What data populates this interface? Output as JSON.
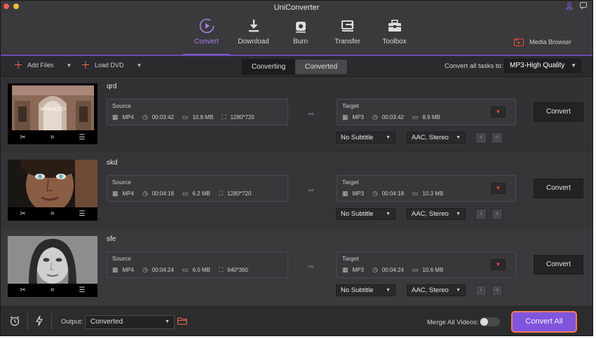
{
  "window": {
    "title": "UniConverter"
  },
  "nav": {
    "items": [
      {
        "id": "convert",
        "label": "Convert",
        "icon": "convert-icon",
        "active": true
      },
      {
        "id": "download",
        "label": "Download",
        "icon": "download-icon",
        "active": false
      },
      {
        "id": "burn",
        "label": "Burn",
        "icon": "disc-icon",
        "active": false
      },
      {
        "id": "transfer",
        "label": "Transfer",
        "icon": "transfer-icon",
        "active": false
      },
      {
        "id": "toolbox",
        "label": "Toolbox",
        "icon": "toolbox-icon",
        "active": false
      }
    ],
    "media_browser": "Media Browser"
  },
  "toolbar": {
    "add_files": "Add Files",
    "load_dvd": "Load DVD",
    "tabs": [
      "Converting",
      "Converted"
    ],
    "convert_all_label": "Convert all tasks to:",
    "convert_all_value": "MP3-High Quality"
  },
  "files": [
    {
      "name": "qrd",
      "source": {
        "label": "Source",
        "format": "MP4",
        "duration": "00:03:42",
        "size": "10.8 MB",
        "resolution": "1280*720"
      },
      "target": {
        "label": "Target",
        "format": "MP3",
        "duration": "00:03:42",
        "size": "8.9 MB"
      },
      "subtitle": "No Subtitle",
      "audio": "AAC, Stereo",
      "convert_label": "Convert"
    },
    {
      "name": "skd",
      "source": {
        "label": "Source",
        "format": "MP4",
        "duration": "00:04:18",
        "size": "6.2 MB",
        "resolution": "1280*720"
      },
      "target": {
        "label": "Target",
        "format": "MP3",
        "duration": "00:04:18",
        "size": "10.3 MB"
      },
      "subtitle": "No Subtitle",
      "audio": "AAC, Stereo",
      "convert_label": "Convert"
    },
    {
      "name": "sfe",
      "source": {
        "label": "Source",
        "format": "MP4",
        "duration": "00:04:24",
        "size": "6.0 MB",
        "resolution": "640*360"
      },
      "target": {
        "label": "Target",
        "format": "MP3",
        "duration": "00:04:24",
        "size": "10.6 MB"
      },
      "subtitle": "No Subtitle",
      "audio": "AAC, Stereo",
      "convert_label": "Convert"
    }
  ],
  "bottom": {
    "output_label": "Output:",
    "output_value": "Converted",
    "merge_label": "Merge All Videos:",
    "merge_enabled": false,
    "convert_all": "Convert All"
  },
  "colors": {
    "accent": "#8e61ec",
    "convert_all_bg": "#7f55dc",
    "convert_all_border": "#f07b4f",
    "add_icon": "#f06d4b",
    "dropdown_arrow": "#e8483c"
  }
}
